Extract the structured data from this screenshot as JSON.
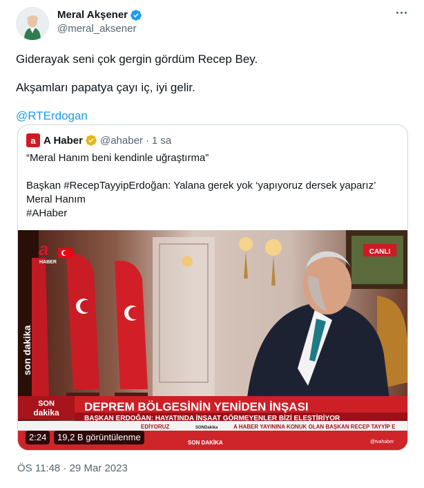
{
  "author": {
    "display_name": "Meral Akşener",
    "handle": "@meral_aksener",
    "verified_color": "#1d9bf0"
  },
  "tweet": {
    "lines": [
      "Giderayak seni çok gergin gördüm Recep Bey.",
      "Akşamları papatya çayı iç, iyi gelir."
    ],
    "mention": "@RTErdogan",
    "timestamp": "ÖS 11:48 · 29 Mar 2023"
  },
  "quote": {
    "logo_letter": "a",
    "name": "A Haber",
    "handle": "@ahaber",
    "separator": "·",
    "time": "1 sa",
    "verified_color": "#e2b719",
    "line1": "“Meral Hanım beni kendinle uğraştırma”",
    "line2": "Başkan #RecepTayyipErdoğan: Yalana gerek yok ‘yapıyoruz dersek yaparız’",
    "line3": "Meral Hanım",
    "line4": "#AHaber"
  },
  "video": {
    "duration": "2:24",
    "views": "19,2 B görüntülenme",
    "live_label": "CANLI",
    "channel_logo": "a",
    "channel_sub": "HABER",
    "side_banner": "son dakika",
    "son_top": "SON",
    "son_bottom": "dakika",
    "headline": "DEPREM BÖLGESİNİN YENİDEN İNŞASI",
    "subheadline": "BAŞKAN ERDOĞAN: HAYATINDA İNŞAAT GÖRMEYENLER BİZİ ELEŞTİRİYOR",
    "ticker_a": "EDİYORUZ",
    "ticker_b": "SONDakika",
    "ticker_c": "A HABER YAYININA KONUK OLAN BAŞKAN RECEP TAYYİP E",
    "bottom_son": "SON DAKİKA",
    "social": "@tvahaber"
  }
}
